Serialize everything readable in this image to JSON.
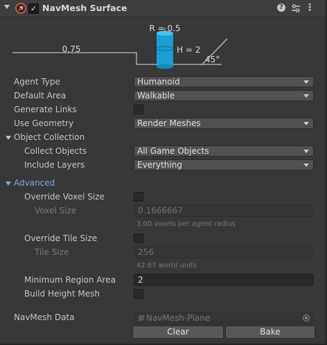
{
  "header": {
    "title": "NavMesh Surface",
    "enabled_check": "✓",
    "help_glyph": "?",
    "more_glyph": "⋮",
    "icons": [
      "foldout-arrow-icon",
      "navmesh-component-icon",
      "help-icon",
      "preset-icon",
      "more-options-icon"
    ]
  },
  "diagram": {
    "radius_label": "R = 0.5",
    "height_label": "H = 2",
    "step_label": "0.75",
    "slope_label": "45°",
    "agent_color": "#1a9fd4"
  },
  "fields": {
    "agent_type": {
      "label": "Agent Type",
      "value": "Humanoid"
    },
    "default_area": {
      "label": "Default Area",
      "value": "Walkable"
    },
    "generate_links": {
      "label": "Generate Links"
    },
    "use_geometry": {
      "label": "Use Geometry",
      "value": "Render Meshes"
    },
    "object_collection": {
      "label": "Object Collection"
    },
    "collect_objects": {
      "label": "Collect Objects",
      "value": "All Game Objects"
    },
    "include_layers": {
      "label": "Include Layers",
      "value": "Everything"
    },
    "advanced": {
      "label": "Advanced",
      "color": "#7ea8e0"
    },
    "override_voxel_size": {
      "label": "Override Voxel Size"
    },
    "voxel_size": {
      "label": "Voxel Size",
      "value": "0.1666667",
      "hint": "3.00 voxels per agent radius"
    },
    "override_tile_size": {
      "label": "Override Tile Size"
    },
    "tile_size": {
      "label": "Tile Size",
      "value": "256",
      "hint": "42.67 world units"
    },
    "minimum_region_area": {
      "label": "Minimum Region Area",
      "value": "2"
    },
    "build_height_mesh": {
      "label": "Build Height Mesh"
    },
    "navmesh_data": {
      "label": "NavMesh Data",
      "value": "NavMesh-Plane"
    }
  },
  "buttons": {
    "clear": "Clear",
    "bake": "Bake"
  },
  "colors": {
    "panel": "#383838",
    "header": "#3e3e3e",
    "accent_blue": "#7ea8e0"
  }
}
